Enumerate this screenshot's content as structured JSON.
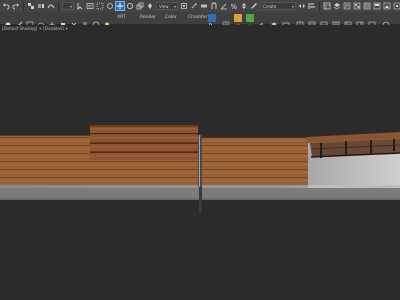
{
  "toolbar": {
    "view_dropdown": "View",
    "selection_set": "Create Selection Set",
    "icons": [
      "undo-icon",
      "redo-icon",
      "link-icon",
      "unlink-icon",
      "bind-space-warp-icon",
      "selection-filter-icon",
      "select-object-icon",
      "select-by-name-icon",
      "select-region-icon",
      "window-crossing-icon",
      "select-move-icon",
      "select-rotate-icon",
      "select-scale-icon",
      "select-place-icon",
      "use-pivot-center-icon",
      "select-manipulate-icon",
      "keyboard-shortcut-icon",
      "snaps-toggle-icon",
      "angle-snap-icon",
      "percent-snap-icon",
      "spinner-snap-icon",
      "edit-named-sets-icon",
      "mirror-icon",
      "align-icon",
      "toggle-scene-explorer-icon",
      "toggle-layer-explorer-icon",
      "graph-editors-icon",
      "material-editor-icon",
      "render-setup-icon",
      "rendered-frame-window-icon",
      "render-production-icon",
      "render-iterative-icon",
      "render-in-cloud-icon"
    ]
  },
  "ribbon": {
    "tabs": [
      "XRT",
      "Render",
      "Color",
      "Chamfer"
    ]
  },
  "viewport": {
    "label": "[Default Shading] + [Disabled] +"
  },
  "colors": {
    "toolbar_bg": "#444444",
    "viewport_bg": "#2b2b2b",
    "active_tool": "#2f6fb3",
    "wood": "#9a6238",
    "wood_dark": "#7b4a28",
    "concrete": "#8f8f8f"
  }
}
